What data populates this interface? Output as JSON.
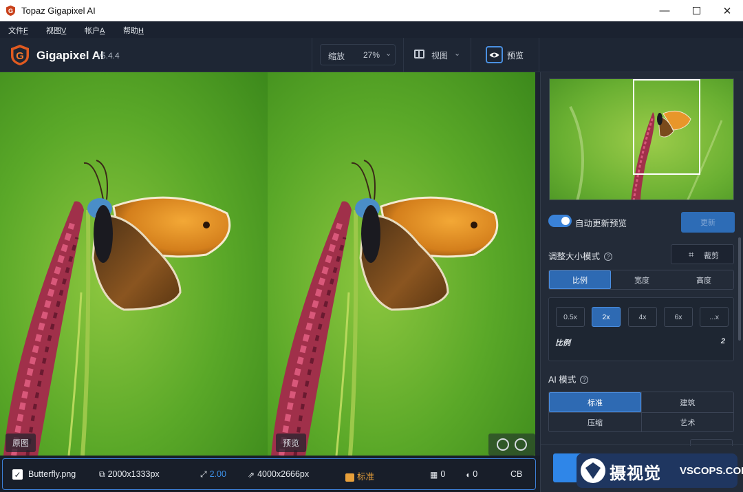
{
  "window": {
    "title": "Topaz Gigapixel AI"
  },
  "menu": [
    {
      "label": "文件",
      "key": "F"
    },
    {
      "label": "视图",
      "key": "V"
    },
    {
      "label": "帐户",
      "key": "A"
    },
    {
      "label": "帮助",
      "key": "H"
    }
  ],
  "toolbar": {
    "brand": "Gigapixel AI",
    "version": "v5.4.4",
    "zoom_label": "缩放",
    "zoom_value": "27%",
    "view_label": "视图",
    "preview_label": "预览"
  },
  "canvas": {
    "original_label": "原图",
    "preview_label": "预览"
  },
  "file": {
    "name": "Butterfly.png",
    "input_size": "2000x1333px",
    "scale": "2.00",
    "output_size": "4000x2666px",
    "mode": "标准",
    "noise": "0",
    "blur": "0",
    "cb_label": "CB"
  },
  "panel": {
    "auto_update_label": "自动更新预览",
    "update_button": "更新",
    "resize_mode_label": "调整大小模式",
    "crop_button": "裁剪",
    "resize_tabs": [
      "比例",
      "宽度",
      "高度"
    ],
    "resize_active": 0,
    "scale_options": [
      "0.5x",
      "2x",
      "4x",
      "6x",
      "...x"
    ],
    "scale_active": 1,
    "ratio_label": "比例",
    "ratio_value": "2",
    "ai_mode_label": "AI 模式",
    "ai_modes": [
      "标准",
      "建筑",
      "压缩",
      "艺术"
    ],
    "ai_active": 0
  },
  "watermark": {
    "brand": "摄视觉",
    "site": "VSCOPS.COM"
  },
  "colors": {
    "accent": "#2e6ab3",
    "accent_bright": "#3a82d8",
    "panel": "#232b38",
    "grass": "#5fae2c"
  }
}
